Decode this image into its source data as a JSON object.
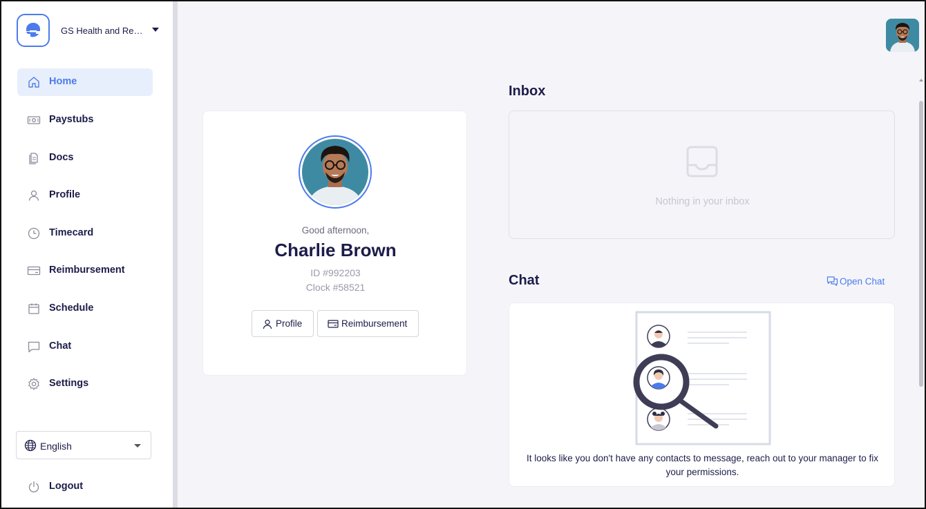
{
  "org": {
    "name": "GS Health and Rehab",
    "logo_icon": "app-logo-icon"
  },
  "nav": {
    "items": [
      {
        "label": "Home",
        "icon": "home-icon",
        "active": true
      },
      {
        "label": "Paystubs",
        "icon": "money-icon"
      },
      {
        "label": "Docs",
        "icon": "document-icon"
      },
      {
        "label": "Profile",
        "icon": "user-icon"
      },
      {
        "label": "Timecard",
        "icon": "clock-icon"
      },
      {
        "label": "Reimbursement",
        "icon": "card-icon"
      },
      {
        "label": "Schedule",
        "icon": "calendar-icon"
      },
      {
        "label": "Chat",
        "icon": "chat-icon"
      },
      {
        "label": "Settings",
        "icon": "gear-icon"
      }
    ],
    "language": "English",
    "logout": "Logout"
  },
  "profile": {
    "greeting": "Good afternoon,",
    "name": "Charlie Brown",
    "id": "ID #992203",
    "clock": "Clock #58521",
    "profile_button": "Profile",
    "reimbursement_button": "Reimbursement"
  },
  "inbox": {
    "title": "Inbox",
    "empty_text": "Nothing in your inbox"
  },
  "chat": {
    "title": "Chat",
    "open_chat": "Open Chat",
    "message": "It looks like you don't have any contacts to message, reach out to your manager to fix your permissions."
  },
  "colors": {
    "accent": "#4b7bec",
    "text": "#1c1c4a",
    "background": "#f5f5f9",
    "active_nav_bg": "#e8effc"
  }
}
